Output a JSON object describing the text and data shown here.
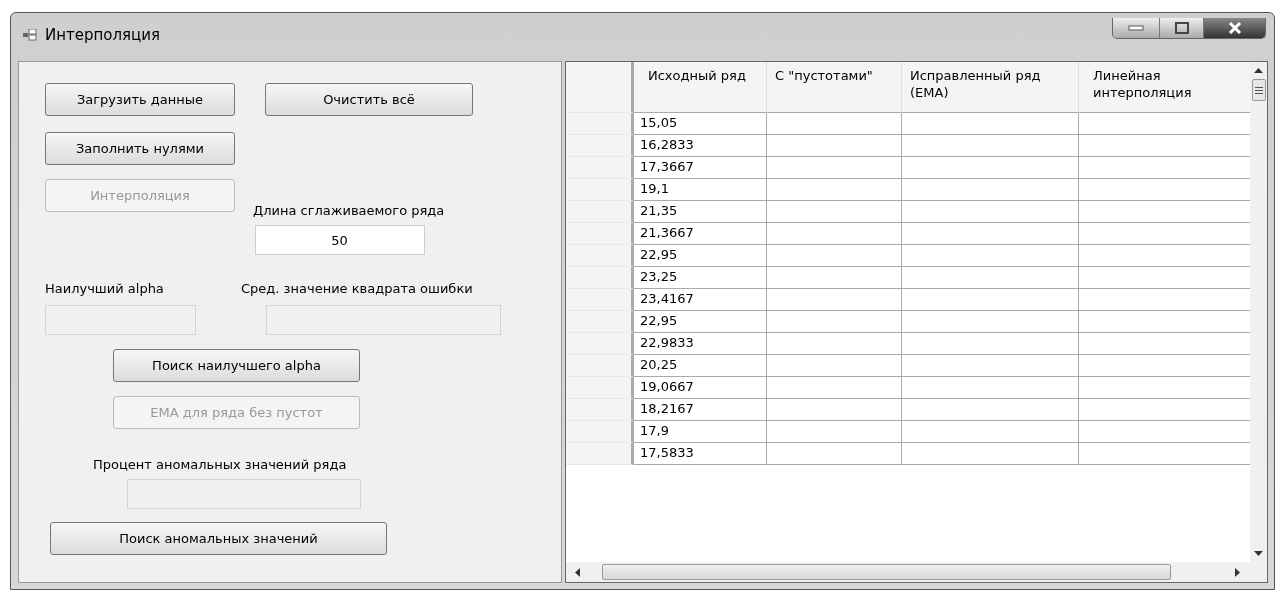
{
  "window": {
    "title": "Интерполяция"
  },
  "controls": {
    "load_button": {
      "label": "Загрузить данные",
      "disabled": false
    },
    "clear_button": {
      "label": "Очистить всё",
      "disabled": false
    },
    "fill_zeros_button": {
      "label": "Заполнить нулями",
      "disabled": false
    },
    "interpolation_button": {
      "label": "Интерполяция",
      "disabled": true
    },
    "length_label": "Длина сглаживаемого ряда",
    "length_field": {
      "value": "50"
    },
    "best_alpha_label": "Наилучший alpha",
    "mse_label": "Сред. значение квадрата ошибки",
    "find_alpha_button": {
      "label": "Поиск наилучшего alpha",
      "disabled": false
    },
    "ema_button": {
      "label": "EMA для ряда без пустот",
      "disabled": true
    },
    "anomaly_percent_label": "Процент аномальных значений ряда",
    "find_anomalies_button": {
      "label": "Поиск аномальных значений",
      "disabled": false
    }
  },
  "table": {
    "columns": [
      "Исходный ряд",
      "С \"пустотами\"",
      "Исправленный ряд (EMA)",
      "Линейная интерполяция"
    ],
    "rows": [
      {
        "cells": [
          "15,05"
        ]
      },
      {
        "cells": [
          "16,2833"
        ]
      },
      {
        "cells": [
          "17,3667"
        ]
      },
      {
        "cells": [
          "19,1"
        ]
      },
      {
        "cells": [
          "21,35"
        ]
      },
      {
        "cells": [
          "21,3667"
        ]
      },
      {
        "cells": [
          "22,95"
        ]
      },
      {
        "cells": [
          "23,25"
        ]
      },
      {
        "cells": [
          "23,4167"
        ]
      },
      {
        "cells": [
          "22,95"
        ]
      },
      {
        "cells": [
          "22,9833"
        ]
      },
      {
        "cells": [
          "20,25"
        ]
      },
      {
        "cells": [
          "19,0667"
        ]
      },
      {
        "cells": [
          "18,2167"
        ]
      },
      {
        "cells": [
          "17,9"
        ]
      },
      {
        "cells": [
          "17,5833"
        ]
      }
    ]
  }
}
